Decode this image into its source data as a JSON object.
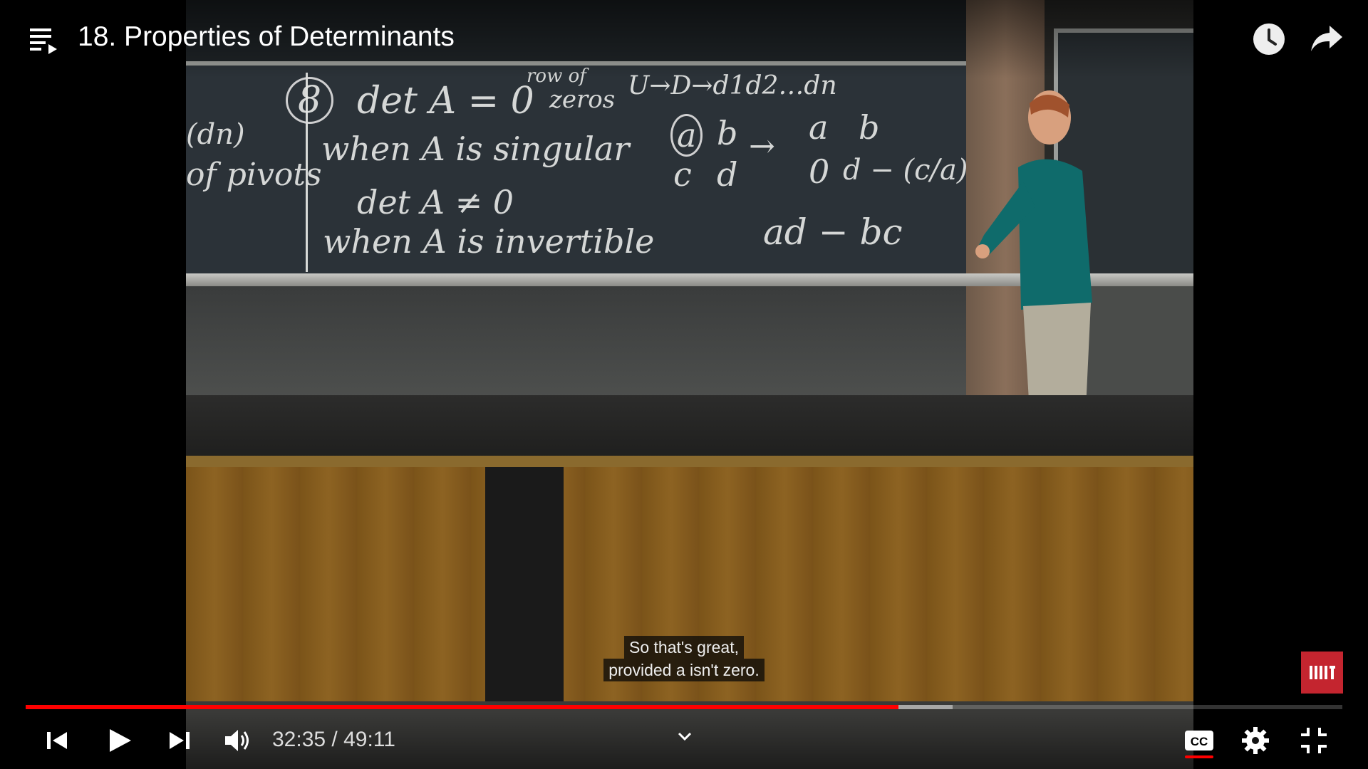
{
  "video": {
    "title": "18. Properties of Determinants",
    "caption_lines": [
      "So that's great,",
      "provided a isn't zero."
    ],
    "board_text": {
      "left_col": [
        "(dn)",
        "of pivots"
      ],
      "item_number": "8",
      "line1": "det A = 0",
      "arrow_note": [
        "row of",
        "zeros"
      ],
      "pivots_note": "U→D→d1d2…dn",
      "line2": "when A is singular",
      "line3": "det A ≠ 0",
      "line4": "when A is invertible",
      "matrix_left": [
        "a",
        "b",
        "c",
        "d"
      ],
      "matrix_right": [
        "a",
        "b",
        "0",
        "d − (c/a) b"
      ],
      "result": "ad − bc"
    }
  },
  "player": {
    "current_time": "32:35",
    "duration": "49:11",
    "time_display": "32:35 / 49:11",
    "played_fraction": 0.663,
    "buffered_fraction": 0.704,
    "captions_on": true
  },
  "icons": {
    "playlist": "playlist-icon",
    "watch_later": "clock-icon",
    "share": "share-icon",
    "prev": "skip-previous-icon",
    "play": "play-icon",
    "next": "skip-next-icon",
    "volume": "volume-icon",
    "chevron": "chevron-down-icon",
    "cc": "closed-captions-icon",
    "settings": "gear-icon",
    "exit_fullscreen": "exit-fullscreen-icon"
  },
  "colors": {
    "progress": "#ff0000",
    "brand_logo": "#c4252f"
  }
}
